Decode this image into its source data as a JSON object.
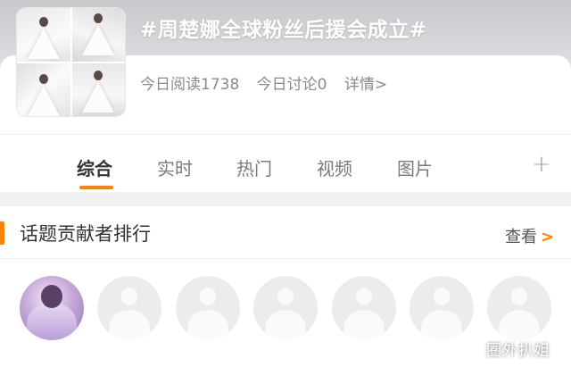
{
  "topic": {
    "title": "#周楚娜全球粉丝后援会成立#",
    "stats": {
      "reads": "今日阅读1738",
      "discussions": "今日讨论0",
      "details": "详情>"
    }
  },
  "tabs": [
    "综合",
    "实时",
    "热门",
    "视频",
    "图片"
  ],
  "active_tab": "综合",
  "add_tab_icon": "plus-icon",
  "contributors": {
    "title": "话题贡献者排行",
    "view_all": "查看",
    "count": 7
  },
  "watermark": "圈外扒姐",
  "colors": {
    "accent": "#ff8200",
    "title_text": "#ffffff",
    "muted_text": "#8a8a8a"
  }
}
